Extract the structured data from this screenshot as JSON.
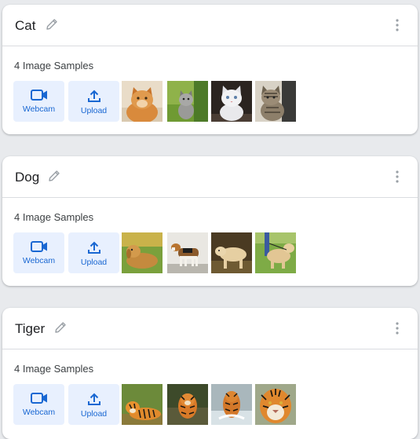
{
  "classes": [
    {
      "name": "Cat",
      "samples_label": "4 Image Samples",
      "webcam_label": "Webcam",
      "upload_label": "Upload",
      "thumbnails": [
        "cat-orange-tabby",
        "cat-grey-kitten-grass",
        "cat-white-kitten",
        "cat-tabby-sitting"
      ]
    },
    {
      "name": "Dog",
      "samples_label": "4 Image Samples",
      "webcam_label": "Webcam",
      "upload_label": "Upload",
      "thumbnails": [
        "dog-golden-retriever-lying",
        "dog-beagle-standing",
        "dog-labrador-yellow",
        "dog-labrador-leash"
      ]
    },
    {
      "name": "Tiger",
      "samples_label": "4 Image Samples",
      "webcam_label": "Webcam",
      "upload_label": "Upload",
      "thumbnails": [
        "tiger-lying-grass",
        "tiger-walking-forest",
        "tiger-leaping-water",
        "tiger-face-portrait"
      ]
    }
  ],
  "colors": {
    "accent": "#1967d2",
    "tile_bg": "#e8f0fe",
    "page_bg": "#e8eaed"
  }
}
